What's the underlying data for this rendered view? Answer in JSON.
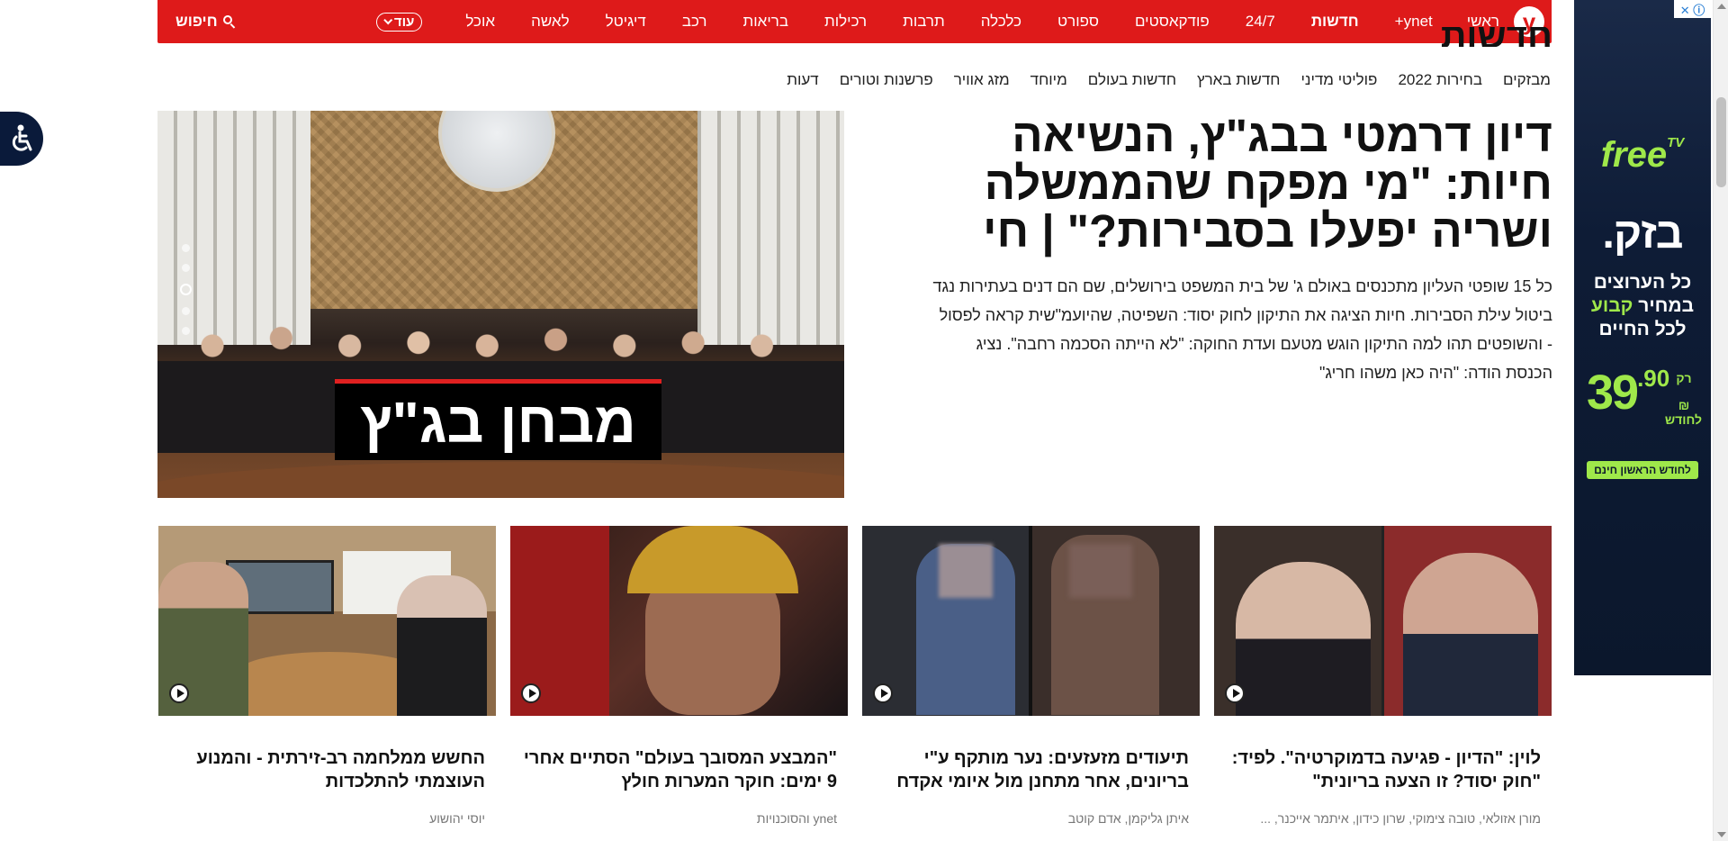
{
  "nav": {
    "logo": "y",
    "items": [
      "ראשי",
      "ynet+",
      "חדשות",
      "24/7",
      "פודקאסטים",
      "ספורט",
      "כלכלה",
      "תרבות",
      "רכילות",
      "בריאות",
      "רכב",
      "דיגיטל",
      "לאשה",
      "אוכל"
    ],
    "more_label": "עוד",
    "search_label": "חיפוש"
  },
  "section_heading": "חדשות",
  "subnav": [
    "מבזקים",
    "בחירות 2022",
    "פוליטי מדיני",
    "חדשות בארץ",
    "חדשות בעולם",
    "מיוחד",
    "מזג אוויר",
    "פרשנות וטורים",
    "דעות"
  ],
  "main_story": {
    "title": "דיון דרמטי בבג\"ץ, הנשיאה חיות: \"מי מפקח שהממשלה ושריה יפעלו בסבירות?\" | חי",
    "subtitle": "כל 15 שופטי העליון מתכנסים באולם ג' של בית המשפט בירושלים, שם הם דנים בעתירות נגד ביטול עילת הסבירות. חיות הציגה את התיקון לחוק יסוד: השפיטה, שהיועמ\"שית קראה לפסול - והשופטים תהו למה התיקון הוגש מטעם ועדת החוקה: \"לא הייתה הסכמה רחבה\". נציג הכנסת הודה: \"היה כאן משהו חריג\"",
    "image_overlay_text": "מבחן בג\"ץ"
  },
  "cards": [
    {
      "title": "לוין: \"הדיון - פגיעה בדמוקרטיה\". לפיד: \"חוק יסוד? זו הצעה בריונית\"",
      "authors": "מורן אזולאי, טובה צימוקי, שרון כידון, איתמר אייכנר, ..."
    },
    {
      "title": "תיעודים מזעזעים: נער מותקף ע\"י בריונים, אחר מתחנן מול איומי אקדח",
      "authors": "איתן גליקמן, אדם קוטב"
    },
    {
      "title": "\"המבצע המסובך בעולם\" הסתיים אחרי 9 ימים: חוקר המערות חולץ",
      "authors": "ynet והסוכנויות"
    },
    {
      "title": "החשש ממלחמה רב-זירתית - והמנוע העוצמתי להתלכדות",
      "authors": "יוסי יהושוע"
    }
  ],
  "ad": {
    "adchoices": "ⓘ ✕",
    "brand_top": "free",
    "brand_top_sup": "TV",
    "brand_main": "בזק.",
    "line1": "כל הערוצים",
    "line2_prefix": "במחיר ",
    "line2_highlight": "קבוע",
    "line3": "לכל החיים",
    "price_prefix": "רק",
    "price_num": "39",
    "price_cents": ".90",
    "currency": "₪",
    "per_month": "לחודש",
    "cta": "לחודש הראשון חינם"
  },
  "colors": {
    "nav_red": "#de1a1a",
    "ad_green": "#9fe84a",
    "ad_navy": "#0b172c"
  }
}
